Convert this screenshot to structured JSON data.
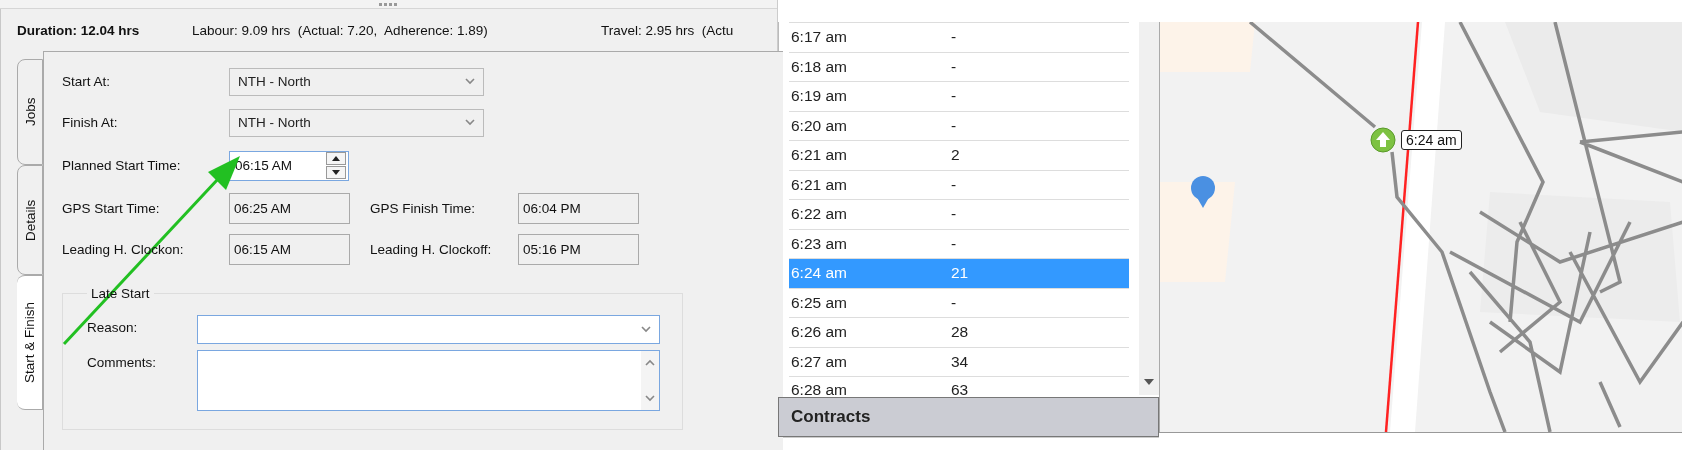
{
  "header": {
    "duration": "Duration: 12.04 hrs",
    "labour": "Labour: 9.09 hrs  (Actual: 7.20,  Adherence: 1.89)",
    "travel": "Travel: 2.95 hrs  (Actu"
  },
  "tabs": [
    {
      "label": "Jobs",
      "selected": false
    },
    {
      "label": "Details",
      "selected": false
    },
    {
      "label": "Start & Finish",
      "selected": true
    }
  ],
  "form_rows": [
    [
      {
        "kind": "combo",
        "label": "Start At:",
        "value": "NTH - North",
        "disabled": true
      }
    ],
    [
      {
        "kind": "combo",
        "label": "Finish At:",
        "value": "NTH - North",
        "disabled": true
      }
    ],
    [
      {
        "kind": "spin",
        "label": "Planned Start Time:",
        "value": "06:15 AM"
      }
    ],
    [
      {
        "kind": "readonly",
        "label": "GPS Start Time:",
        "value": "06:25 AM"
      },
      {
        "kind": "readonly",
        "label": "GPS Finish Time:",
        "value": "06:04 PM"
      }
    ],
    [
      {
        "kind": "readonly",
        "label": "Leading H. Clockon:",
        "value": "06:15 AM"
      },
      {
        "kind": "readonly",
        "label": "Leading H. Clockoff:",
        "value": "05:16 PM"
      }
    ]
  ],
  "late_start": {
    "title": "Late Start",
    "reason_label": "Reason:",
    "comments_label": "Comments:"
  },
  "time_list": {
    "rows": [
      {
        "time": "6:17 am",
        "count": "-",
        "selected": false
      },
      {
        "time": "6:18 am",
        "count": "-",
        "selected": false
      },
      {
        "time": "6:19 am",
        "count": "-",
        "selected": false
      },
      {
        "time": "6:20 am",
        "count": "-",
        "selected": false
      },
      {
        "time": "6:21 am",
        "count": "2",
        "selected": false
      },
      {
        "time": "6:21 am",
        "count": "-",
        "selected": false
      },
      {
        "time": "6:22 am",
        "count": "-",
        "selected": false
      },
      {
        "time": "6:23 am",
        "count": "-",
        "selected": false
      },
      {
        "time": "6:24 am",
        "count": "21",
        "selected": true
      },
      {
        "time": "6:25 am",
        "count": "-",
        "selected": false
      },
      {
        "time": "6:26 am",
        "count": "28",
        "selected": false
      },
      {
        "time": "6:27 am",
        "count": "34",
        "selected": false
      },
      {
        "time": "6:28 am",
        "count": "63",
        "selected": false
      }
    ],
    "footer": "Contracts"
  },
  "map": {
    "kind": "picture",
    "marker_label": "6:24 am"
  }
}
